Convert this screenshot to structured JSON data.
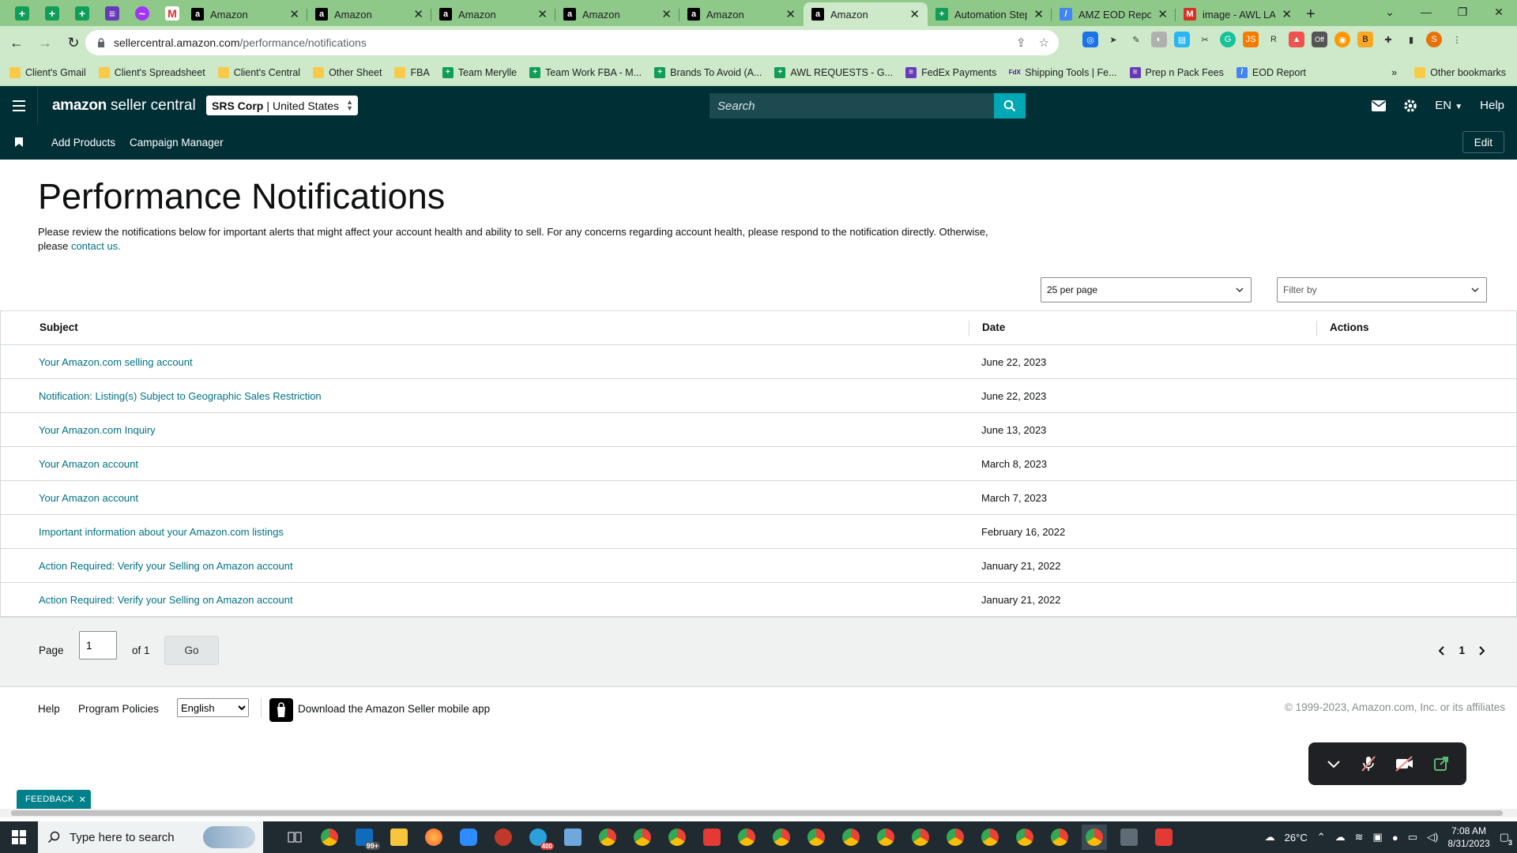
{
  "browser": {
    "tabs": [
      {
        "label": "Amazon",
        "active": false
      },
      {
        "label": "Amazon",
        "active": false
      },
      {
        "label": "Amazon",
        "active": false
      },
      {
        "label": "Amazon",
        "active": false
      },
      {
        "label": "Amazon",
        "active": false
      },
      {
        "label": "Amazon",
        "active": true
      },
      {
        "label": "Automation Step",
        "active": false
      },
      {
        "label": "AMZ EOD Report",
        "active": false
      },
      {
        "label": "image - AWL LAB",
        "active": false
      }
    ],
    "url_host": "sellercentral.amazon.com",
    "url_path": "/performance/notifications",
    "bookmarks": [
      "Client's Gmail",
      "Client's Spreadsheet",
      "Client's Central",
      "Other Sheet",
      "FBA",
      "Team Merylle",
      "Team Work FBA - M...",
      "Brands To Avoid (A...",
      "AWL REQUESTS - G...",
      "FedEx Payments",
      "Shipping Tools | Fe...",
      "Prep n Pack Fees",
      "EOD Report"
    ],
    "other_bookmarks": "Other bookmarks",
    "profile_initial": "S",
    "ext_badge": "Off"
  },
  "header": {
    "logo_brand": "amazon",
    "logo_product": "seller central",
    "account_name": "SRS Corp",
    "account_region": "United States",
    "search_placeholder": "Search",
    "language": "EN",
    "help": "Help"
  },
  "subnav": {
    "links": [
      "Add Products",
      "Campaign Manager"
    ],
    "edit": "Edit"
  },
  "page": {
    "title": "Performance Notifications",
    "description": "Please review the notifications below for important alerts that might affect your account health and ability to sell. For any concerns regarding account health, please respond to the notification directly. Otherwise, please",
    "contact_link": "contact us.",
    "per_page": "25 per page",
    "filter_placeholder": "Filter by"
  },
  "table": {
    "columns": [
      "Subject",
      "Date",
      "Actions"
    ],
    "rows": [
      {
        "subject": "Your Amazon.com selling account",
        "date": "June 22, 2023"
      },
      {
        "subject": "Notification: Listing(s) Subject to Geographic Sales Restriction",
        "date": "June 22, 2023"
      },
      {
        "subject": "Your Amazon.com Inquiry",
        "date": "June 13, 2023"
      },
      {
        "subject": "Your Amazon account",
        "date": "March 8, 2023"
      },
      {
        "subject": "Your Amazon account",
        "date": "March 7, 2023"
      },
      {
        "subject": "Important information about your Amazon.com listings",
        "date": "February 16, 2022"
      },
      {
        "subject": "Action Required: Verify your Selling on Amazon account",
        "date": "January 21, 2022"
      },
      {
        "subject": "Action Required: Verify your Selling on Amazon account",
        "date": "January 21, 2022"
      }
    ]
  },
  "pagination": {
    "page_label": "Page",
    "page_value": "1",
    "of_label": "of 1",
    "go": "Go",
    "current": "1"
  },
  "footer": {
    "help": "Help",
    "policies": "Program Policies",
    "language": "English",
    "app_link": "Download the Amazon Seller mobile app",
    "copyright": "© 1999-2023, Amazon.com, Inc. or its affiliates"
  },
  "feedback": "FEEDBACK",
  "taskbar": {
    "search_placeholder": "Type here to search",
    "badge": "99+",
    "badge2": "400",
    "temperature": "26°C",
    "time": "7:08 AM",
    "date": "8/31/2023",
    "notifications": "3"
  },
  "colors": {
    "chrome_frame": "#8fc98a",
    "chrome_toolbar": "#cde9c9",
    "header": "#002f36",
    "link": "#007185",
    "search_button": "#00a8b5",
    "feedback": "#00808a"
  }
}
